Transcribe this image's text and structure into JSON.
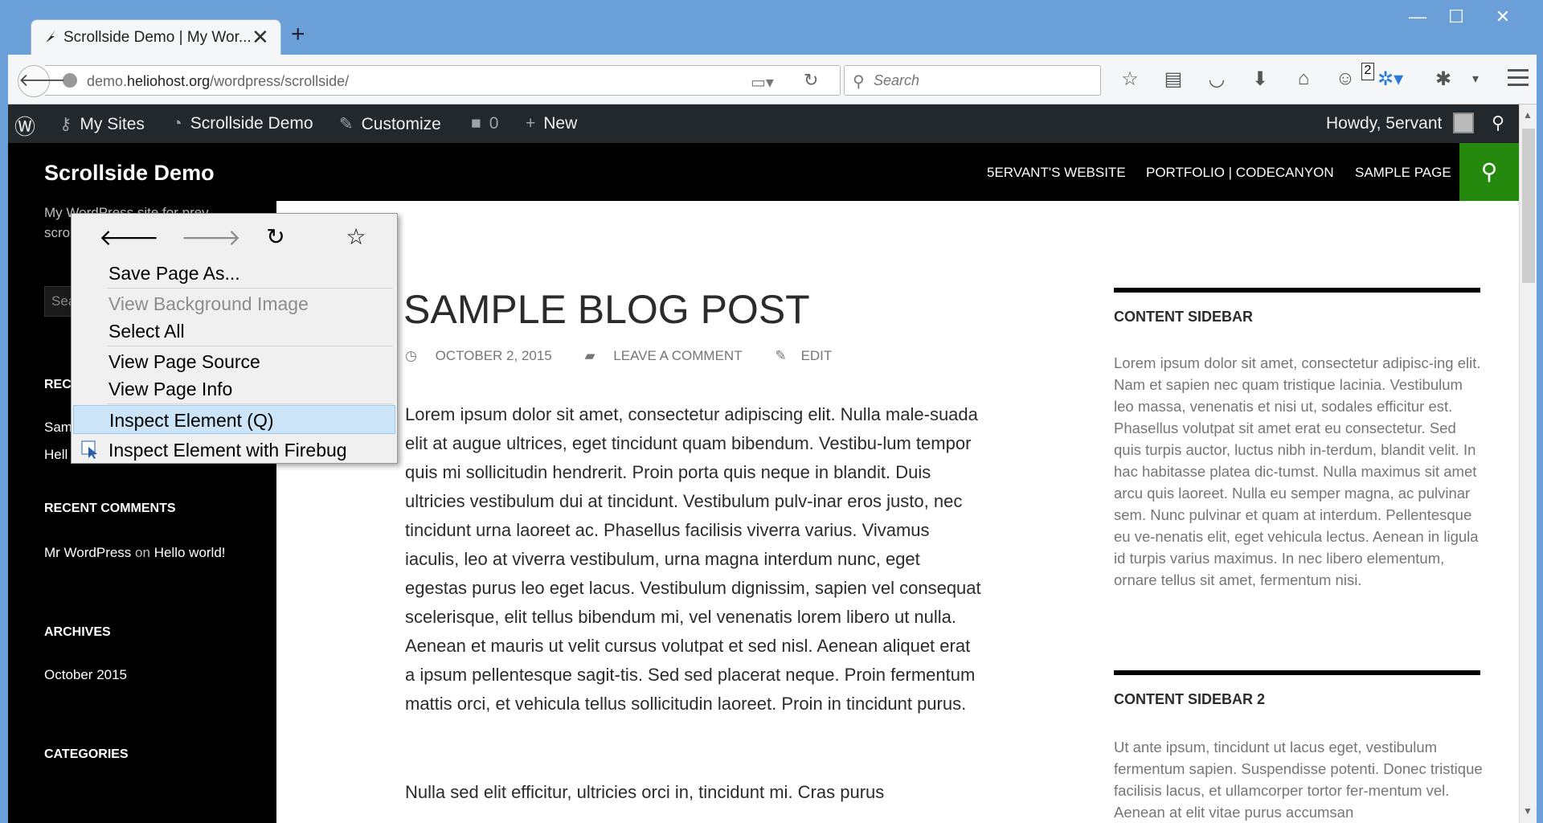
{
  "browser": {
    "tab_title": "Scrollside Demo | My Wor...",
    "tab_close": "✕",
    "new_tab": "+",
    "window_buttons": {
      "minimize": "—",
      "maximize": "☐",
      "close": "✕"
    },
    "url_prefix": "demo.",
    "url_host": "heliohost.org",
    "url_path": "/wordpress/scrollside/",
    "search_placeholder": "Search",
    "badge_count": "2"
  },
  "adminbar": {
    "my_sites": "My Sites",
    "site_name": "Scrollside Demo",
    "customize": "Customize",
    "comments_count": "0",
    "new": "New",
    "howdy": "Howdy, 5ervant"
  },
  "site": {
    "title": "Scrollside Demo",
    "tagline": "My WordPress site for prev... scro...",
    "nav": [
      "5ERVANT'S WEBSITE",
      "PORTFOLIO | CODECANYON",
      "SAMPLE PAGE"
    ],
    "search_placeholder": "Sea"
  },
  "left_sidebar": {
    "recent_posts_title": "RECE",
    "recent_posts": [
      "Sam",
      "Hell"
    ],
    "recent_comments_title": "RECENT COMMENTS",
    "recent_comment_author": "Mr WordPress",
    "recent_comment_on": "on",
    "recent_comment_post": "Hello world!",
    "archives_title": "ARCHIVES",
    "archive_item": "October 2015",
    "categories_title": "CATEGORIES"
  },
  "post": {
    "title": "SAMPLE BLOG POST",
    "date": "OCTOBER 2, 2015",
    "comment_link": "LEAVE A COMMENT",
    "edit_link": "EDIT",
    "paragraph1": "Lorem ipsum dolor sit amet, consectetur adipiscing elit. Nulla male-suada elit at augue ultrices, eget tincidunt quam bibendum. Vestibu-lum tempor quis mi sollicitudin hendrerit. Proin porta quis neque in blandit. Duis ultricies vestibulum dui at tincidunt. Vestibulum pulv-inar eros justo, nec tincidunt urna laoreet ac. Phasellus facilisis viverra varius. Vivamus iaculis, leo at viverra vestibulum, urna magna interdum nunc, eget egestas purus leo eget lacus. Vestibulum dignissim, sapien vel consequat scelerisque, elit tellus bibendum mi, vel venenatis lorem libero ut nulla. Aenean et mauris ut velit cursus volutpat et sed nisl. Aenean aliquet erat a ipsum pellentesque sagit-tis. Sed sed placerat neque. Proin fermentum mattis orci, et vehicula tellus sollicitudin laoreet. Proin in tincidunt purus.",
    "paragraph2": "Nulla sed elit efficitur, ultricies orci in, tincidunt mi. Cras purus"
  },
  "content_sidebar": {
    "title1": "CONTENT SIDEBAR",
    "text1": "Lorem ipsum dolor sit amet, consectetur adipisc-ing elit. Nam et sapien nec quam tristique lacinia. Vestibulum leo massa, venenatis et nisi ut, sodales efficitur est. Phasellus volutpat sit amet erat eu consectetur. Sed quis turpis auctor, luctus nibh in-terdum, blandit velit. In hac habitasse platea dic-tumst. Nulla maximus sit amet arcu quis laoreet. Nulla eu semper magna, ac pulvinar sem. Nunc pulvinar et quam at interdum. Pellentesque eu ve-nenatis elit, eget vehicula lectus. Aenean in ligula id turpis varius maximus. In nec libero elementum, ornare tellus sit amet, fermentum nisi.",
    "title2": "CONTENT SIDEBAR 2",
    "text2": "Ut ante ipsum, tincidunt ut lacus eget, vestibulum fermentum sapien. Suspendisse potenti. Donec tristique facilisis lacus, et ullamcorper tortor fer-mentum vel. Aenean at elit vitae purus accumsan"
  },
  "context_menu": {
    "items": {
      "save_page_as": "Save Page As...",
      "view_background_image": "View Background Image",
      "select_all": "Select All",
      "view_page_source": "View Page Source",
      "view_page_info": "View Page Info",
      "inspect_element": "Inspect Element (Q)",
      "inspect_firebug": "Inspect Element with Firebug"
    },
    "disabled": [
      "view_background_image"
    ],
    "highlighted": "inspect_element"
  },
  "colors": {
    "window_frame": "#6a9fd8",
    "admin_bar": "#23282d",
    "accent_green": "#24890d",
    "menu_highlight": "#cce4f7"
  }
}
